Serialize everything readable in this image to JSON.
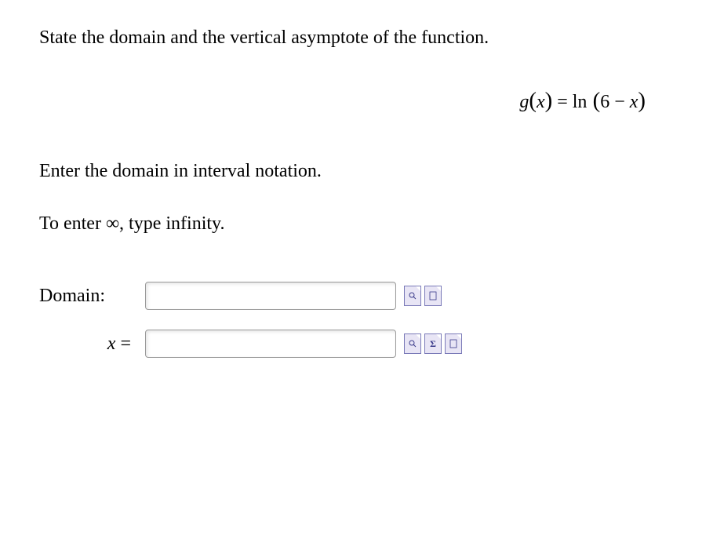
{
  "question": {
    "prompt": "State the domain and the vertical asymptote of the function.",
    "equation_g": "g",
    "equation_x1": "x",
    "equation_eq": " = ",
    "equation_ln": "ln",
    "equation_open": " (",
    "equation_6": "6 − ",
    "equation_x2": "x",
    "equation_close": ")",
    "instruction": "Enter the domain in interval notation.",
    "hint": "To enter ∞, type infinity."
  },
  "answers": {
    "domain_label": "Domain:",
    "domain_value": "",
    "x_label_var": "x",
    "x_label_eq": " =",
    "x_value": ""
  },
  "icons": {
    "preview": "🔍",
    "help": "?",
    "sigma": "Σ"
  }
}
